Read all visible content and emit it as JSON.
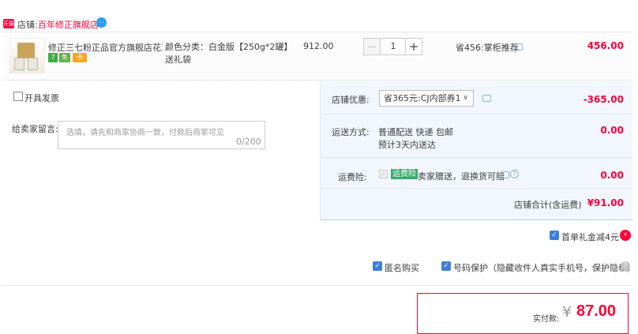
{
  "shop": {
    "badge": "天猫",
    "label": "店铺:",
    "name": "百年修正旗舰店",
    "ww_icon": "ww-chat-icon"
  },
  "item": {
    "title": "修正三七粉正品官方旗舰店花正...",
    "tags": {
      "seven": "7",
      "free": "免",
      "card": "卡"
    },
    "spec_line1": "颜色分类：白金版【250g*2罐】",
    "spec_line2": "送礼袋",
    "unit_price": "912.00",
    "qty_minus": "−",
    "quantity": "1",
    "qty_plus": "+",
    "promo": "省456:掌柜推荐",
    "total": "456.00"
  },
  "invoice": {
    "label": "开具发票"
  },
  "message": {
    "label": "给卖家留言:",
    "placeholder": "选填，请先和商家协商一致，付款后商家可见",
    "count": "0/200"
  },
  "discount": {
    "label": "店铺优惠:",
    "selected": "省365元:CJ内部券1",
    "chevron": "∨",
    "amount": "-365.00"
  },
  "shipping": {
    "label": "运送方式:",
    "line1": "普通配送 快递 包邮",
    "line2": "预计3天内送达",
    "amount": "0.00"
  },
  "insurance": {
    "label": "运费险:",
    "check": "✓",
    "tag": "运费险",
    "text": "卖家赠送，退换货可赔",
    "help": "?",
    "amount": "0.00"
  },
  "subtotal": {
    "label": "店铺合计(含运费)",
    "amount": "¥91.00"
  },
  "options": {
    "gift_check": "✓",
    "gift_label": "首单礼金减4元",
    "bolt": "⚡",
    "anon_check": "✓",
    "anon_label": "匿名购买",
    "phone_check": "✓",
    "phone_label": "号码保护（隐藏收件人真实手机号，保护隐私）",
    "phone_help": "?"
  },
  "pay": {
    "label": "实付款:",
    "currency": "¥",
    "amount": "87.00"
  },
  "colors": {
    "accent": "#ff0036",
    "check_blue": "#3d7edb",
    "panel_bg": "#f2f7ff"
  }
}
